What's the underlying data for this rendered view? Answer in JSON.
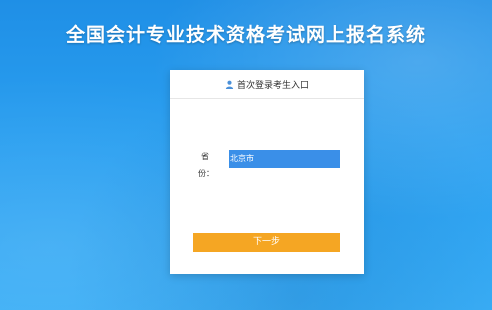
{
  "page": {
    "title": "全国会计专业技术资格考试网上报名系统"
  },
  "login_card": {
    "header": "首次登录考生入口",
    "header_icon": "user-icon",
    "province_label_line1": "省",
    "province_label_line2": "份：",
    "province_value": "北京市",
    "next_label": "下一步"
  },
  "colors": {
    "background": "#2a9ff0",
    "select_bg": "#3a8fe8",
    "button_bg": "#f5a623"
  }
}
